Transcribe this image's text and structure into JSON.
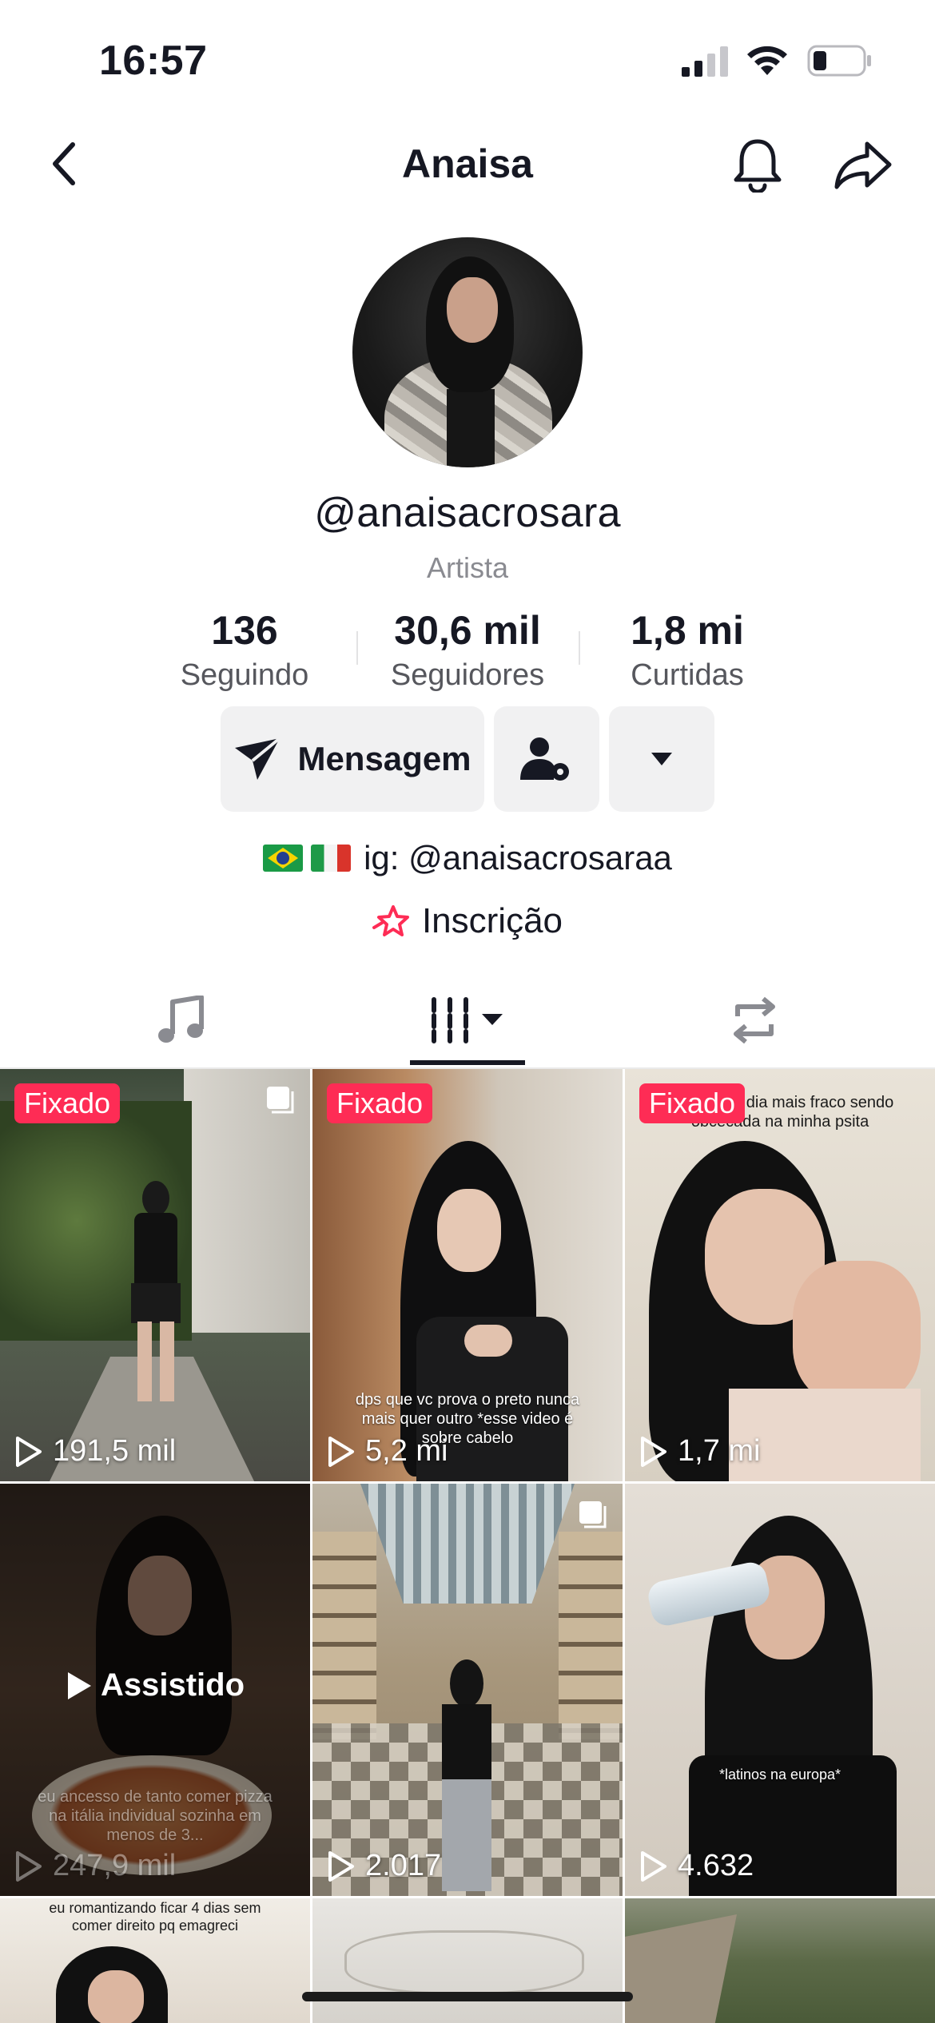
{
  "status_bar": {
    "time": "16:57"
  },
  "header": {
    "title": "Anaisa"
  },
  "profile": {
    "username": "@anaisacrosara",
    "category": "Artista",
    "stats": [
      {
        "value": "136",
        "label": "Seguindo"
      },
      {
        "value": "30,6 mil",
        "label": "Seguidores"
      },
      {
        "value": "1,8 mi",
        "label": "Curtidas"
      }
    ],
    "message_button": "Mensagem",
    "bio": "ig: @anaisacrosaraa",
    "link_label": "Inscrição"
  },
  "grid": [
    {
      "badge": "Fixado",
      "views": "191,5 mil",
      "multi": true
    },
    {
      "badge": "Fixado",
      "views": "5,2 mi",
      "caption": "dps que vc prova o preto nunca mais quer outro *esse video é sobre cabelo"
    },
    {
      "badge": "Fixado",
      "views": "1,7 mi",
      "caption": "eu no meu dia mais fraco sendo obcecada na minha psita"
    },
    {
      "views": "247,9 mil",
      "watched": "Assistido",
      "caption": "eu ancesso de tanto comer pizza na itália individual sozinha em menos de 3..."
    },
    {
      "views": "2.017",
      "multi": true
    },
    {
      "views": "4.632",
      "caption": "*latinos na europa*"
    },
    {
      "caption": "eu romantizando ficar 4 dias sem comer direito pq emagreci"
    },
    {},
    {}
  ],
  "colors": {
    "accent": "#fe2c55",
    "text": "#161823",
    "muted": "#8a8b91",
    "button_bg": "#f1f1f2"
  }
}
